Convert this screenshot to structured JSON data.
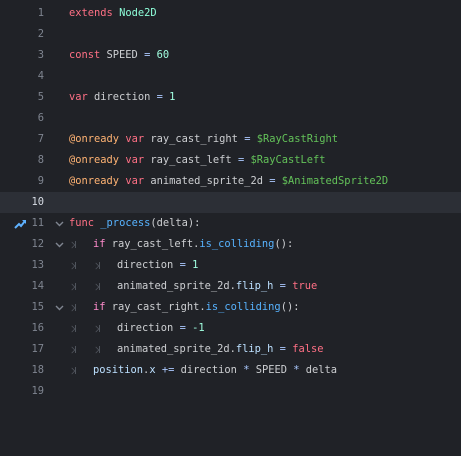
{
  "editor": {
    "current_line": 10,
    "lines": [
      {
        "n": "1",
        "tokens": [
          {
            "t": "extends",
            "c": "kw"
          },
          {
            "t": " "
          },
          {
            "t": "Node2D",
            "c": "cls"
          }
        ]
      },
      {
        "n": "2",
        "tokens": []
      },
      {
        "n": "3",
        "tokens": [
          {
            "t": "const",
            "c": "kw"
          },
          {
            "t": " SPEED "
          },
          {
            "t": "=",
            "c": "op"
          },
          {
            "t": " "
          },
          {
            "t": "60",
            "c": "num"
          }
        ]
      },
      {
        "n": "4",
        "tokens": []
      },
      {
        "n": "5",
        "tokens": [
          {
            "t": "var",
            "c": "kw"
          },
          {
            "t": " direction "
          },
          {
            "t": "=",
            "c": "op"
          },
          {
            "t": " "
          },
          {
            "t": "1",
            "c": "num"
          }
        ]
      },
      {
        "n": "6",
        "tokens": []
      },
      {
        "n": "7",
        "tokens": [
          {
            "t": "@onready",
            "c": "ann"
          },
          {
            "t": " "
          },
          {
            "t": "var",
            "c": "kw"
          },
          {
            "t": " ray_cast_right "
          },
          {
            "t": "=",
            "c": "op"
          },
          {
            "t": " "
          },
          {
            "t": "$RayCastRight",
            "c": "node"
          }
        ]
      },
      {
        "n": "8",
        "tokens": [
          {
            "t": "@onready",
            "c": "ann"
          },
          {
            "t": " "
          },
          {
            "t": "var",
            "c": "kw"
          },
          {
            "t": " ray_cast_left "
          },
          {
            "t": "=",
            "c": "op"
          },
          {
            "t": " "
          },
          {
            "t": "$RayCastLeft",
            "c": "node"
          }
        ]
      },
      {
        "n": "9",
        "tokens": [
          {
            "t": "@onready",
            "c": "ann"
          },
          {
            "t": " "
          },
          {
            "t": "var",
            "c": "kw"
          },
          {
            "t": " animated_sprite_2d "
          },
          {
            "t": "=",
            "c": "op"
          },
          {
            "t": " "
          },
          {
            "t": "$AnimatedSprite2D",
            "c": "node"
          }
        ]
      },
      {
        "n": "10",
        "tokens": []
      },
      {
        "n": "11",
        "fold": true,
        "override_icon": true,
        "tokens": [
          {
            "t": "func",
            "c": "kw"
          },
          {
            "t": " "
          },
          {
            "t": "_process",
            "c": "fn"
          },
          {
            "t": "(delta):"
          }
        ]
      },
      {
        "n": "12",
        "fold": true,
        "indent": 1,
        "tokens": [
          {
            "t": "if",
            "c": "ctl"
          },
          {
            "t": " ray_cast_left."
          },
          {
            "t": "is_colliding",
            "c": "fn"
          },
          {
            "t": "():"
          }
        ]
      },
      {
        "n": "13",
        "indent": 2,
        "tokens": [
          {
            "t": "direction "
          },
          {
            "t": "=",
            "c": "op"
          },
          {
            "t": " "
          },
          {
            "t": "1",
            "c": "num"
          }
        ]
      },
      {
        "n": "14",
        "indent": 2,
        "tokens": [
          {
            "t": "animated_sprite_2d."
          },
          {
            "t": "flip_h",
            "c": "member"
          },
          {
            "t": " "
          },
          {
            "t": "=",
            "c": "op"
          },
          {
            "t": " "
          },
          {
            "t": "true",
            "c": "kw"
          }
        ]
      },
      {
        "n": "15",
        "fold": true,
        "indent": 1,
        "tokens": [
          {
            "t": "if",
            "c": "ctl"
          },
          {
            "t": " ray_cast_right."
          },
          {
            "t": "is_colliding",
            "c": "fn"
          },
          {
            "t": "():"
          }
        ]
      },
      {
        "n": "16",
        "indent": 2,
        "tokens": [
          {
            "t": "direction "
          },
          {
            "t": "=",
            "c": "op"
          },
          {
            "t": " "
          },
          {
            "t": "-1",
            "c": "num"
          }
        ]
      },
      {
        "n": "17",
        "indent": 2,
        "tokens": [
          {
            "t": "animated_sprite_2d."
          },
          {
            "t": "flip_h",
            "c": "member"
          },
          {
            "t": " "
          },
          {
            "t": "=",
            "c": "op"
          },
          {
            "t": " "
          },
          {
            "t": "false",
            "c": "kw"
          }
        ]
      },
      {
        "n": "18",
        "indent": 1,
        "tokens": [
          {
            "t": "position",
            "c": "member"
          },
          {
            "t": "."
          },
          {
            "t": "x",
            "c": "member"
          },
          {
            "t": " "
          },
          {
            "t": "+=",
            "c": "op"
          },
          {
            "t": " direction "
          },
          {
            "t": "*",
            "c": "op"
          },
          {
            "t": " SPEED "
          },
          {
            "t": "*",
            "c": "op"
          },
          {
            "t": " delta"
          }
        ]
      },
      {
        "n": "19",
        "tokens": []
      }
    ]
  }
}
